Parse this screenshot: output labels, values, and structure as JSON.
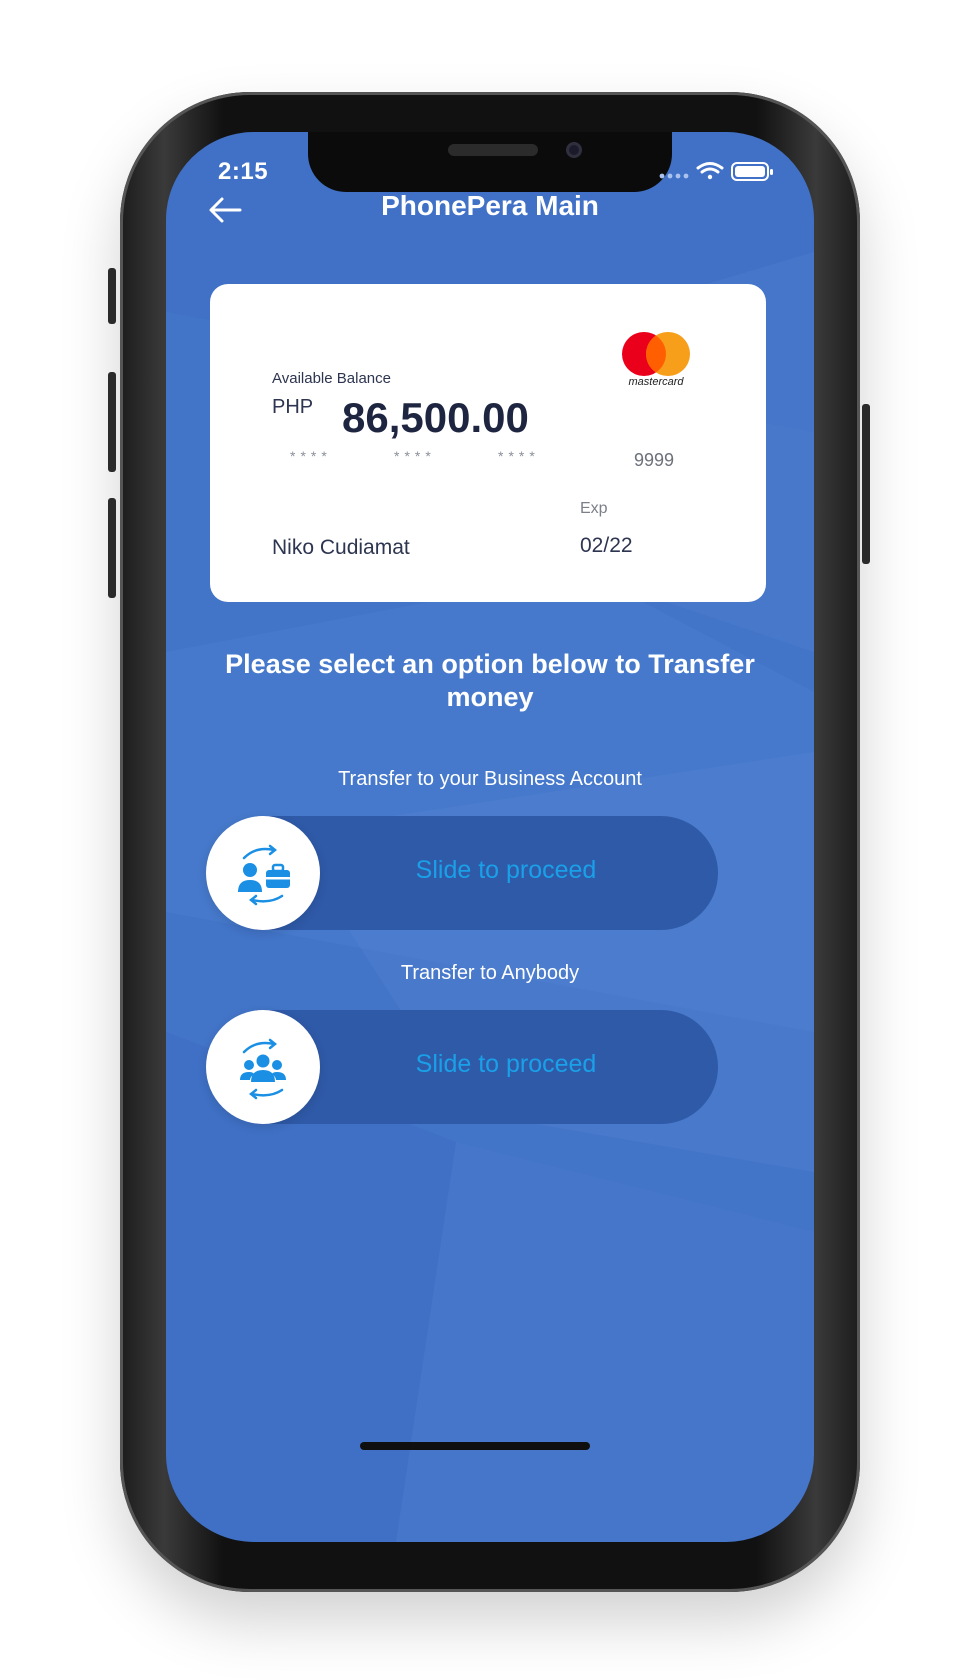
{
  "status_bar": {
    "time": "2:15"
  },
  "header": {
    "title": "PhonePera Main",
    "back_icon": "arrow-left-icon"
  },
  "card": {
    "balance_label": "Available Balance",
    "currency": "PHP",
    "amount": "86,500.00",
    "masked_group_1": "****",
    "masked_group_2": "****",
    "masked_group_3": "****",
    "last_four": "9999",
    "exp_label": "Exp",
    "exp_value": "02/22",
    "holder_name": "Niko Cudiamat",
    "brand": "mastercard"
  },
  "main": {
    "prompt": "Please select an option below to Transfer money",
    "options": [
      {
        "label": "Transfer to your Business Account",
        "slider_text": "Slide to proceed",
        "icon": "person-briefcase-transfer-icon"
      },
      {
        "label": "Transfer to Anybody",
        "slider_text": "Slide to proceed",
        "icon": "group-transfer-icon"
      }
    ]
  },
  "colors": {
    "background": "#4274c8",
    "slider_track": "#2f5aa8",
    "slider_text": "#1aa0e8",
    "icon": "#1a8fe3"
  }
}
